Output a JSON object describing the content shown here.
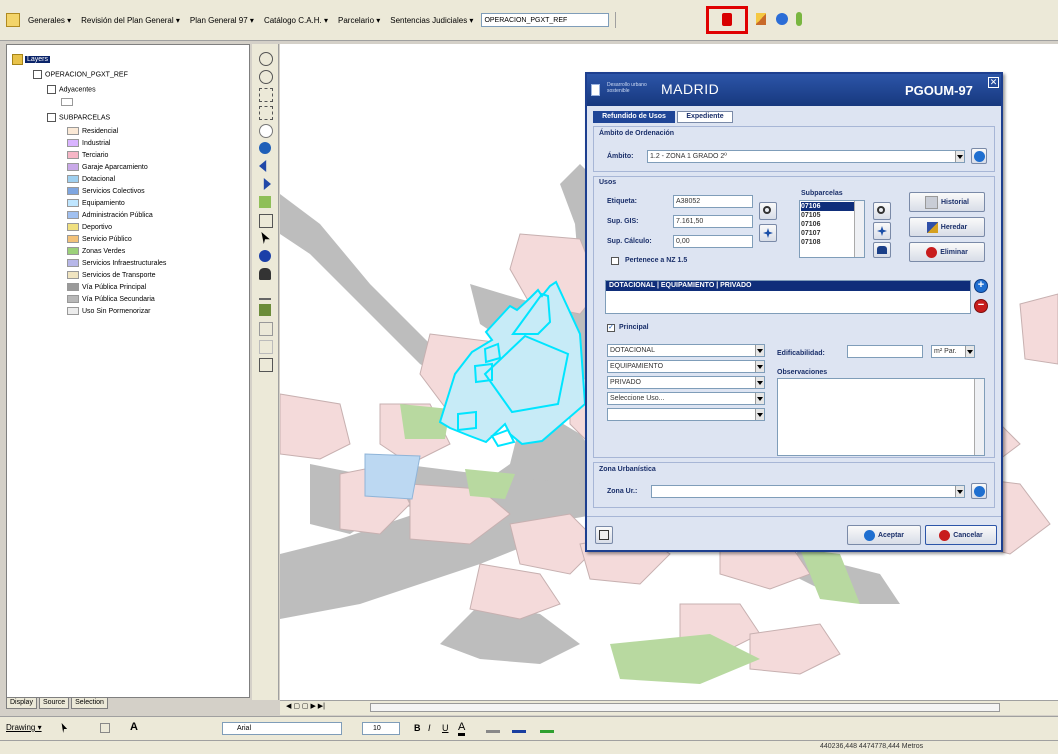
{
  "toolbar": {
    "items": [
      "Generales ▾",
      "Revisión del Plan General ▾",
      "Plan General 97 ▾",
      "Catálogo C.A.H. ▾",
      "Parcelario ▾",
      "Sentencias Judiciales ▾"
    ],
    "layer_combo": "OPERACION_PGXT_REF"
  },
  "toc": {
    "root": "Layers",
    "group": "OPERACION_PGXT_REF",
    "sublayer1": "Adyacentes",
    "sublayer2": "SUBPARCELAS",
    "legend": [
      {
        "label": "Residencial",
        "color": "#fbe9d6"
      },
      {
        "label": "Industrial",
        "color": "#d9b4ff"
      },
      {
        "label": "Terciario",
        "color": "#f6b6c6"
      },
      {
        "label": "Garaje Aparcamiento",
        "color": "#c9a9e8"
      },
      {
        "label": "Dotacional",
        "color": "#9fd0f0"
      },
      {
        "label": "Servicios Colectivos",
        "color": "#7fa6e0"
      },
      {
        "label": "Equipamiento",
        "color": "#bfe6ff"
      },
      {
        "label": "Administración Pública",
        "color": "#a0c0f0"
      },
      {
        "label": "Deportivo",
        "color": "#f0e080"
      },
      {
        "label": "Servicio Público",
        "color": "#f3c27a"
      },
      {
        "label": "Zonas Verdes",
        "color": "#9cd17a"
      },
      {
        "label": "Servicios Infraestructurales",
        "color": "#b7b7e8"
      },
      {
        "label": "Servicios de Transporte",
        "color": "#f0e4c0"
      },
      {
        "label": "Vía Pública Principal",
        "color": "#9a9a9a"
      },
      {
        "label": "Vía Pública Secundaria",
        "color": "#b8b8b8"
      },
      {
        "label": "Uso Sin Pormenorizar",
        "color": "#ececec"
      }
    ],
    "tabs": [
      "Display",
      "Source",
      "Selection"
    ]
  },
  "navbar": {
    "text": "◀ ▢ ▢ ▶ ▶|"
  },
  "drawbar": {
    "drawing": "Drawing ▾",
    "font": "Arial",
    "size": "10",
    "bold": "B",
    "italic": "I",
    "underline": "U",
    "fontcolor": "A"
  },
  "status": {
    "coords": "440236,448  4474778,444 Metros"
  },
  "dialog": {
    "logo_small": "Desarrollo urbano sostenible",
    "logo_city": "MADRID",
    "brand": "PGOUM-97",
    "tabs": [
      "Refundido de Usos",
      "Expediente"
    ],
    "ambito_group": "Ámbito de Ordenación",
    "ambito_label": "Ámbito:",
    "ambito_value": "1.2 - ZONA 1 GRADO 2º",
    "usos_group": "Usos",
    "etiqueta_label": "Etiqueta:",
    "etiqueta_value": "A38052",
    "supgis_label": "Sup. GIS:",
    "supgis_value": "7.161,50",
    "supcalc_label": "Sup. Cálculo:",
    "supcalc_value": "0,00",
    "pertenece_label": "Pertenece a NZ 1.5",
    "subparcelas_label": "Subparcelas",
    "subparcelas": [
      "07106",
      "07105",
      "07106",
      "07107",
      "07108"
    ],
    "btn_historial": "Historial",
    "btn_heredar": "Heredar",
    "btn_eliminar": "Eliminar",
    "uso_list": [
      "DOTACIONAL | EQUIPAMIENTO | PRIVADO"
    ],
    "principal_label": "Principal",
    "uso_dd": [
      "DOTACIONAL",
      "EQUIPAMIENTO",
      "PRIVADO",
      "Seleccione Uso..."
    ],
    "edif_label": "Edificabilidad:",
    "edif_unit": "m² Par.",
    "obs_label": "Observaciones",
    "zona_group": "Zona Urbanística",
    "zona_label": "Zona Ur.:",
    "btn_aceptar": "Aceptar",
    "btn_cancelar": "Cancelar"
  },
  "colors": {
    "map_block": "#f4dada",
    "map_road": "#bdbdbd",
    "map_green": "#b8d9a0",
    "map_blue": "#bcd8f2",
    "selection": "#00e5ff",
    "dialog_head": "#1f4597",
    "highlight": "#0f2e7a"
  }
}
